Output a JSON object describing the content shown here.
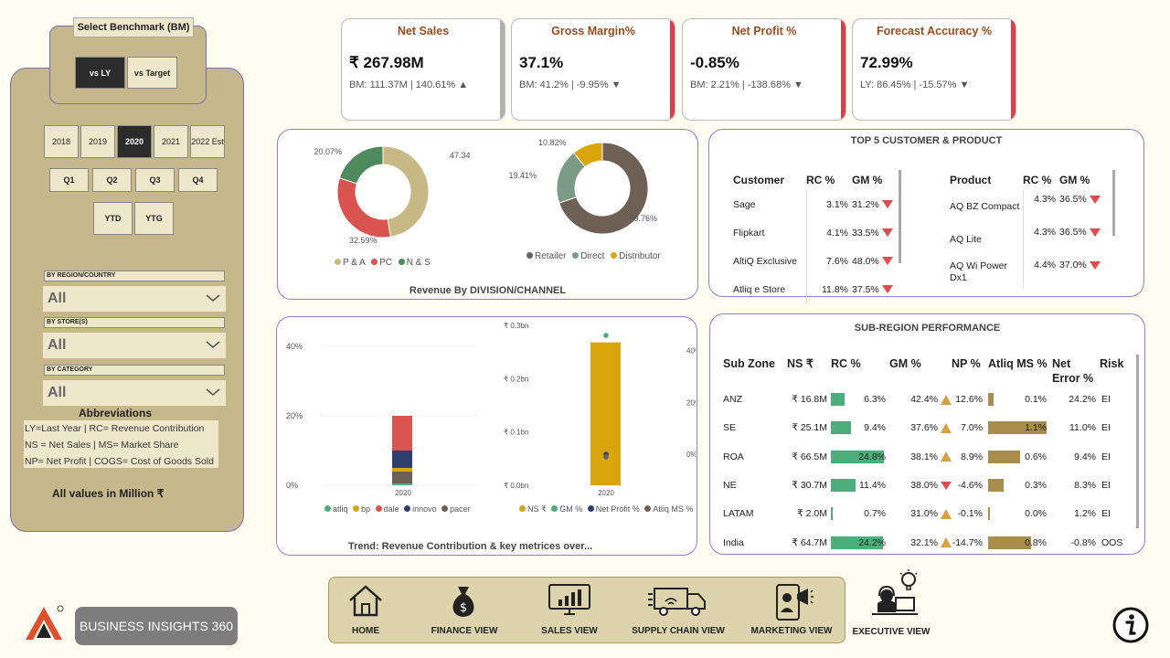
{
  "benchmark": {
    "title": "Select Benchmark (BM)",
    "options": [
      "vs LY",
      "vs Target"
    ],
    "selected": "vs LY"
  },
  "years": [
    {
      "label": "2018",
      "active": false
    },
    {
      "label": "2019",
      "active": false
    },
    {
      "label": "2020",
      "active": true
    },
    {
      "label": "2021",
      "active": false
    },
    {
      "label": "2022 Est",
      "active": false
    }
  ],
  "quarters": [
    "Q1",
    "Q2",
    "Q3",
    "Q4"
  ],
  "period_buttons": [
    "YTD",
    "YTG"
  ],
  "filters": [
    {
      "label": "BY REGION/COUNTRY",
      "value": "All"
    },
    {
      "label": "BY STORE(S)",
      "value": "All"
    },
    {
      "label": "BY CATEGORY",
      "value": "All"
    }
  ],
  "abbreviations": {
    "title": "Abbreviations",
    "lines": [
      "LY=Last Year | RC= Revenue Contribution",
      "NS = Net Sales | MS= Market Share",
      "NP= Net Profit | COGS= Cost of Goods Sold"
    ]
  },
  "units_note": "All values in Million ₹",
  "brand": {
    "name": "BUSINESS INSIGHTS 360"
  },
  "kpis": [
    {
      "title": "Net Sales",
      "value": "₹ 267.98M",
      "sub": "BM: 111.37M | 140.61% ▲",
      "bar_color": "#b0b0b0"
    },
    {
      "title": "Gross Margin%",
      "value": "37.1%",
      "sub": "BM: 41.2% | -9.95% ▼",
      "bar_color": "#d9404f"
    },
    {
      "title": "Net Profit %",
      "value": "-0.85%",
      "sub": "BM: 2.21% | -138.68% ▼",
      "bar_color": "#d9404f"
    },
    {
      "title": "Forecast Accuracy %",
      "value": "72.99%",
      "sub": "LY: 86.45% | -15.57% ▼",
      "bar_color": "#d9404f"
    }
  ],
  "division_card": {
    "title": "Revenue By DIVISION/CHANNEL"
  },
  "chart_data": [
    {
      "type": "pie",
      "variant": "donut",
      "categories": [
        "P & A",
        "PC",
        "N & S"
      ],
      "values": [
        47.34,
        32.59,
        20.07
      ],
      "labels": [
        "47.34%",
        "32.59%",
        "20.07%"
      ],
      "colors": [
        "#c8b883",
        "#d9534f",
        "#4e8a5c"
      ],
      "legend_placement": "bottom"
    },
    {
      "type": "pie",
      "variant": "donut",
      "categories": [
        "Retailer",
        "Direct",
        "Distributor"
      ],
      "values": [
        69.76,
        19.41,
        10.82
      ],
      "labels": [
        "69.76%",
        "19.41%",
        "10.82%"
      ],
      "colors": [
        "#6e6055",
        "#7c9b87",
        "#d9a50c"
      ],
      "legend_placement": "bottom"
    },
    {
      "type": "bar",
      "stacked": true,
      "categories": [
        "2020"
      ],
      "series": [
        {
          "name": "atliq",
          "values": [
            0.5
          ],
          "color": "#4cae7a"
        },
        {
          "name": "bp",
          "values": [
            1.0
          ],
          "color": "#d9a50c"
        },
        {
          "name": "dale",
          "values": [
            10
          ],
          "color": "#d9534f"
        },
        {
          "name": "innovo",
          "values": [
            5
          ],
          "color": "#2e3e6e"
        },
        {
          "name": "pacer",
          "values": [
            3.5
          ],
          "color": "#6e6055"
        }
      ],
      "yticks": [
        "0%",
        "20%",
        "40%"
      ],
      "ylim": [
        0,
        40
      ],
      "legend_placement": "bottom"
    },
    {
      "type": "bar",
      "categories": [
        "2020"
      ],
      "series": [
        {
          "name": "NS ₹",
          "values": [
            0.268
          ],
          "color": "#d9a50c"
        },
        {
          "name": "GM %",
          "values": [
            37.1
          ],
          "color": "#4cae7a"
        },
        {
          "name": "Net Profit %",
          "values": [
            -0.85
          ],
          "color": "#2e3e6e"
        },
        {
          "name": "Atliq MS %",
          "values": [
            0
          ],
          "color": "#6e6055"
        }
      ],
      "yticks_left": [
        "₹ 0.0bn",
        "₹ 0.1bn",
        "₹ 0.2bn",
        "₹ 0.3bn"
      ],
      "yticks_right": [
        "0%",
        "20%",
        "40%"
      ],
      "legend_placement": "bottom"
    }
  ],
  "trend_card": {
    "title": "Trend: Revenue Contribution & key metrices over..."
  },
  "top5": {
    "title": "TOP 5 CUSTOMER & PRODUCT",
    "customer_headers": [
      "Customer",
      "RC %",
      "GM %"
    ],
    "customers": [
      {
        "name": "Sage",
        "rc": "3.1%",
        "gm": "31.2%"
      },
      {
        "name": "Flipkart",
        "rc": "4.1%",
        "gm": "33.5%"
      },
      {
        "name": "AltiQ Exclusive",
        "rc": "7.6%",
        "gm": "48.0%"
      },
      {
        "name": "Atliq e Store",
        "rc": "11.8%",
        "gm": "37.5%"
      }
    ],
    "product_headers": [
      "Product",
      "RC %",
      "GM %"
    ],
    "products": [
      {
        "name": "AQ BZ Compact",
        "rc": "4.3%",
        "gm": "36.5%"
      },
      {
        "name": "AQ Lite",
        "rc": "4.3%",
        "gm": "36.5%"
      },
      {
        "name": "AQ Wi Power Dx1",
        "rc": "4.4%",
        "gm": "37.0%"
      }
    ]
  },
  "subregion": {
    "title": "SUB-REGION PERFORMANCE",
    "headers": [
      "Sub Zone",
      "NS ₹",
      "RC %",
      "GM %",
      "NP %",
      "Atliq MS %",
      "Net Error %",
      "Risk"
    ],
    "rows": [
      {
        "zone": "ANZ",
        "ns": "₹ 16.8M",
        "rc": "6.3%",
        "rc_v": 6.3,
        "gm": "42.4%",
        "gm_up": true,
        "np": "12.6%",
        "ms": "0.1%",
        "ms_v": 0.1,
        "err": "24.2%",
        "risk": "EI"
      },
      {
        "zone": "SE",
        "ns": "₹ 25.1M",
        "rc": "9.4%",
        "rc_v": 9.4,
        "gm": "37.6%",
        "gm_up": true,
        "np": "7.0%",
        "ms": "1.1%",
        "ms_v": 1.1,
        "err": "11.0%",
        "risk": "EI"
      },
      {
        "zone": "ROA",
        "ns": "₹ 66.5M",
        "rc": "24.8%",
        "rc_v": 24.8,
        "gm": "38.1%",
        "gm_up": true,
        "np": "8.9%",
        "ms": "0.6%",
        "ms_v": 0.6,
        "err": "9.4%",
        "risk": "EI"
      },
      {
        "zone": "NE",
        "ns": "₹ 30.7M",
        "rc": "11.4%",
        "rc_v": 11.4,
        "gm": "38.0%",
        "gm_up": false,
        "np": "-4.6%",
        "ms": "0.3%",
        "ms_v": 0.3,
        "err": "8.3%",
        "risk": "EI"
      },
      {
        "zone": "LATAM",
        "ns": "₹ 2.0M",
        "rc": "0.7%",
        "rc_v": 0.7,
        "gm": "31.0%",
        "gm_up": true,
        "np": "-0.1%",
        "ms": "0.0%",
        "ms_v": 0.02,
        "err": "1.2%",
        "risk": "EI"
      },
      {
        "zone": "India",
        "ns": "₹ 64.7M",
        "rc": "24.2%",
        "rc_v": 24.2,
        "gm": "32.1%",
        "gm_up": true,
        "np": "-14.7%",
        "ms": "0.8%",
        "ms_v": 0.8,
        "err": "-0.8%",
        "risk": "OOS"
      }
    ]
  },
  "nav": [
    {
      "label": "HOME",
      "icon": "home-icon"
    },
    {
      "label": "FINANCE VIEW",
      "icon": "money-bag-icon"
    },
    {
      "label": "SALES VIEW",
      "icon": "monitor-chart-icon"
    },
    {
      "label": "SUPPLY CHAIN VIEW",
      "icon": "truck-icon"
    },
    {
      "label": "MARKETING VIEW",
      "icon": "megaphone-icon"
    },
    {
      "label": "EXECUTIVE VIEW",
      "icon": "executive-icon"
    }
  ],
  "colors": {
    "panel": "#c6b88a",
    "accent_red": "#d9404f",
    "green": "#4cae7a",
    "gold": "#a88d4e"
  }
}
